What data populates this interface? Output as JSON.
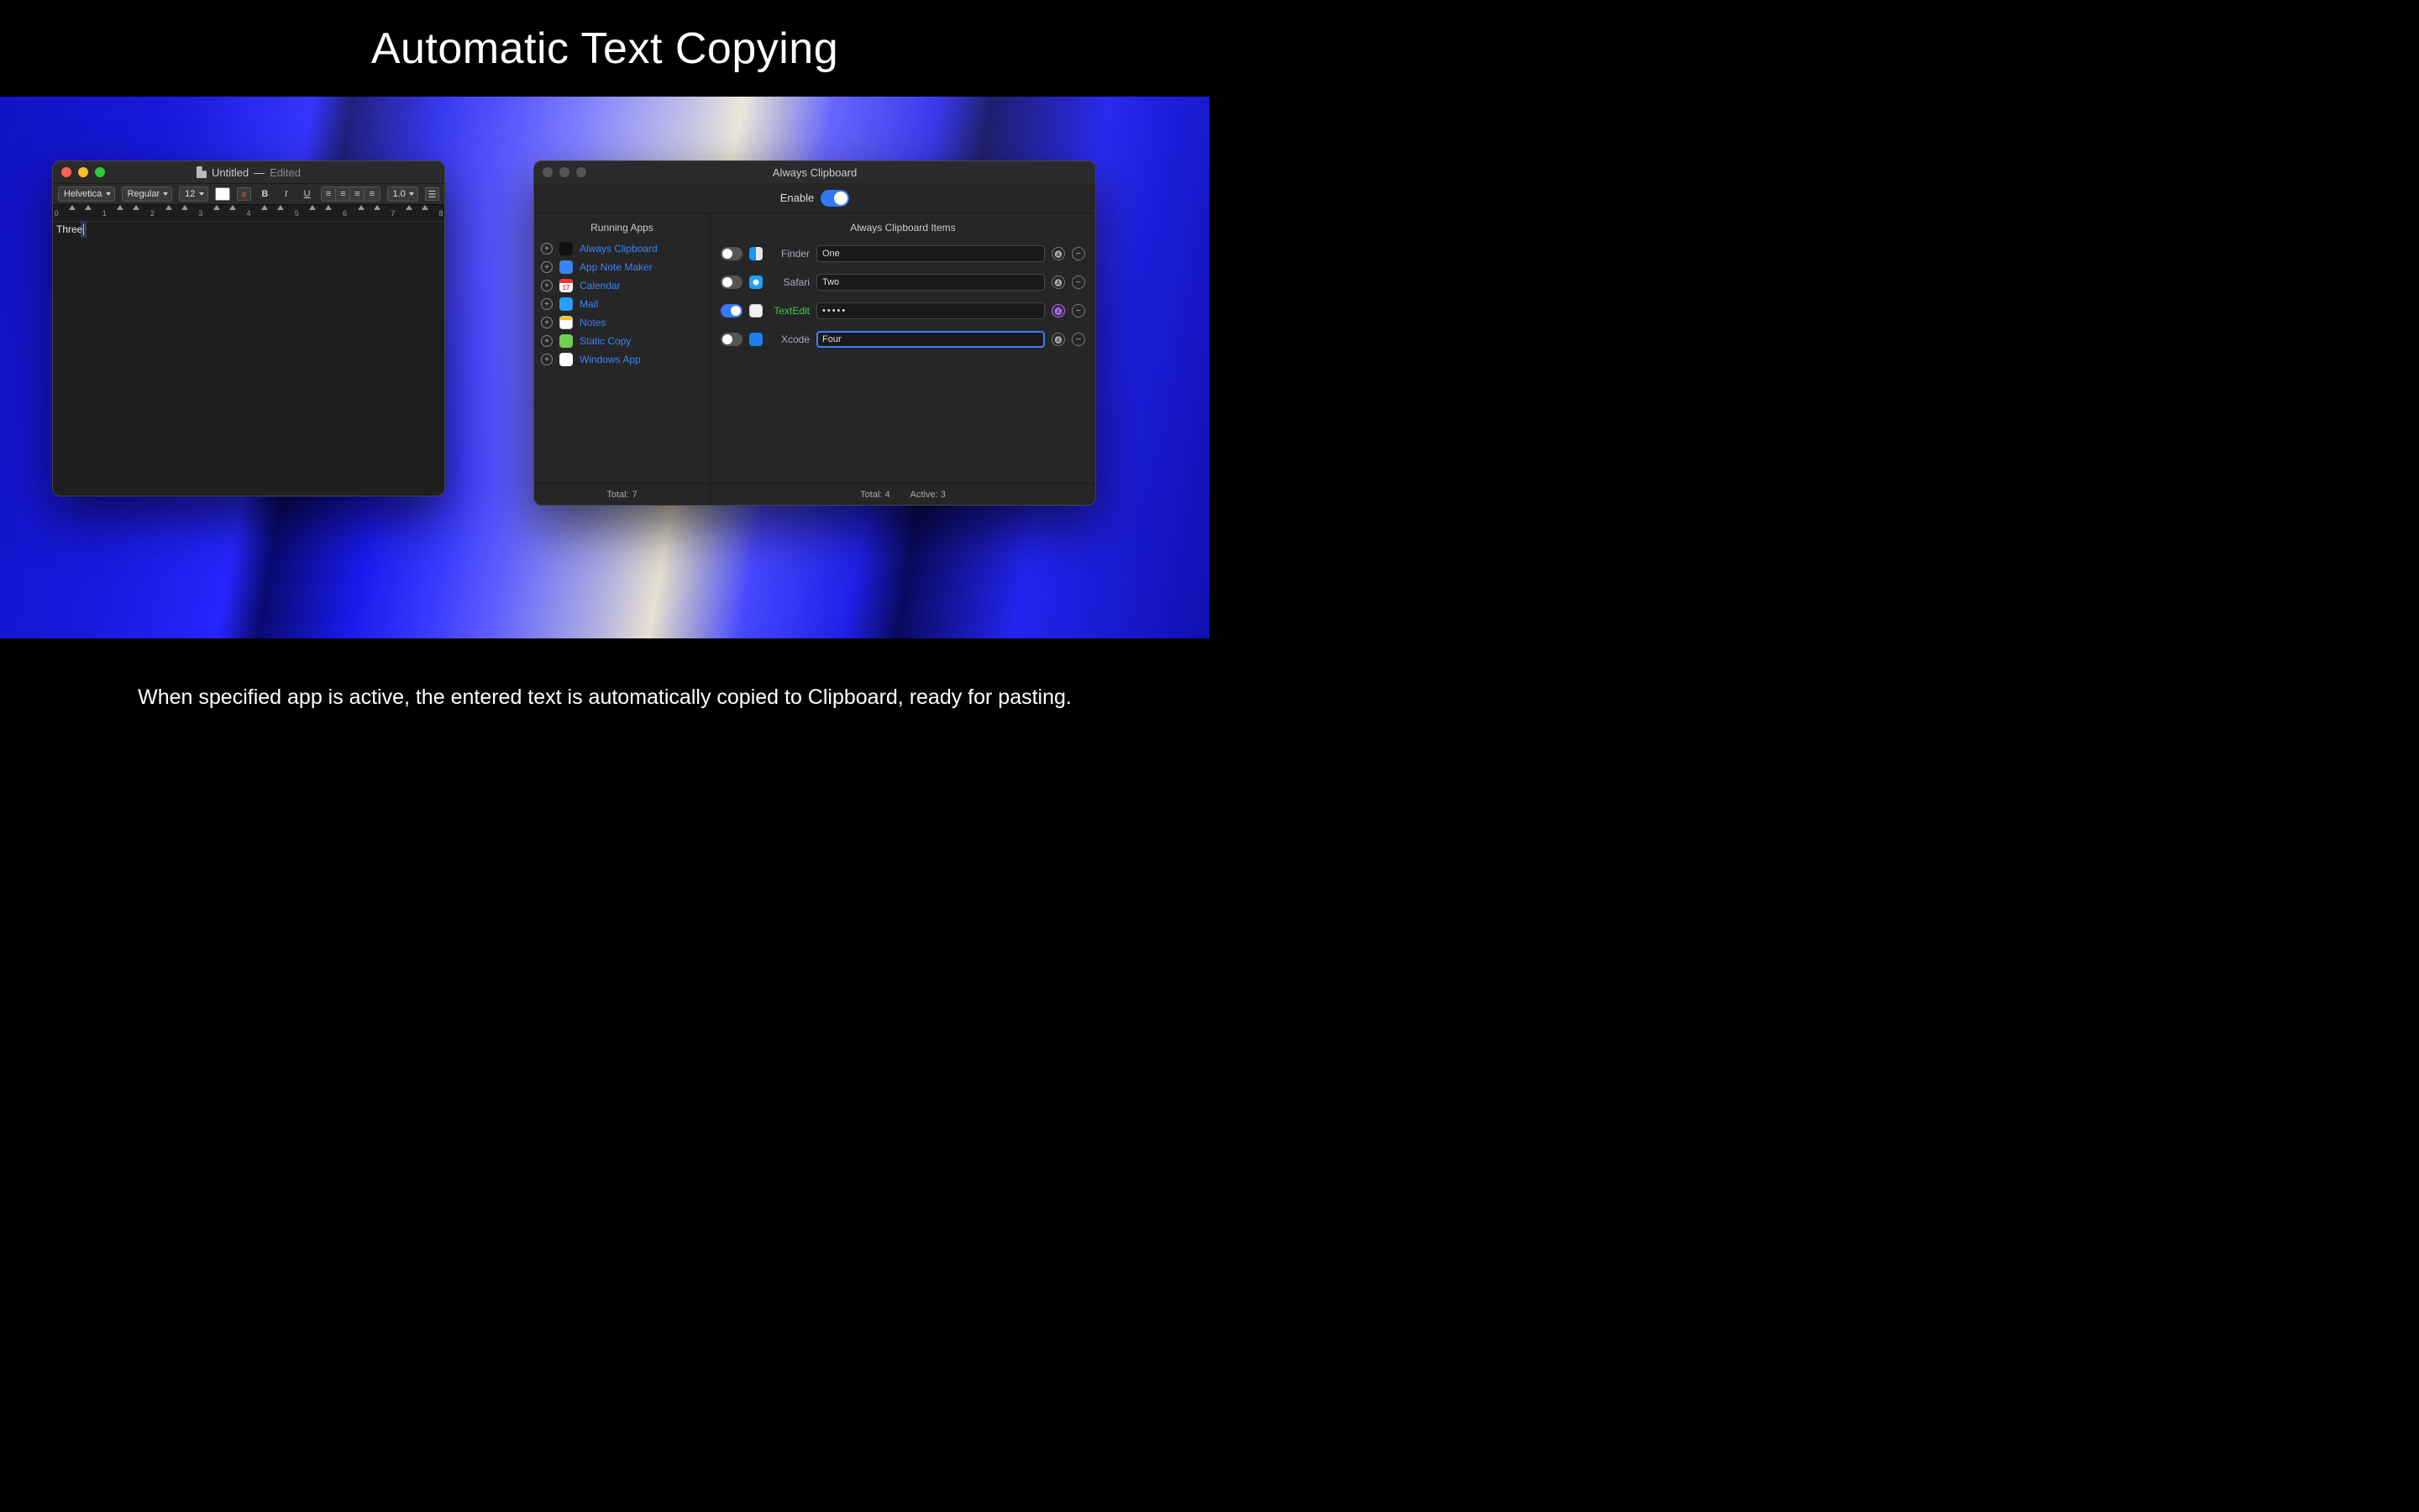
{
  "header": {
    "title": "Automatic Text Copying"
  },
  "footer": {
    "caption": "When specified app is active, the entered text is automatically copied to Clipboard, ready for pasting."
  },
  "textedit": {
    "title_filename": "Untitled",
    "title_status": "Edited",
    "toolbar": {
      "font_family": "Helvetica",
      "font_style": "Regular",
      "font_size": "12",
      "a_style_label": "a",
      "bold_label": "B",
      "italic_label": "I",
      "underline_label": "U",
      "line_spacing": "1.0"
    },
    "ruler_marks": [
      "0",
      "1",
      "2",
      "3",
      "4",
      "5",
      "6",
      "7",
      "8"
    ],
    "document_text": "Three"
  },
  "clipboard": {
    "window_title": "Always Clipboard",
    "enable_label": "Enable",
    "enable_on": true,
    "left": {
      "header": "Running Apps",
      "apps": [
        {
          "name": "Always Clipboard",
          "icon": "ic-alwaysclip"
        },
        {
          "name": "App Note Maker",
          "icon": "ic-appnote"
        },
        {
          "name": "Calendar",
          "icon": "ic-calendar",
          "badge": "17"
        },
        {
          "name": "Mail",
          "icon": "ic-mail"
        },
        {
          "name": "Notes",
          "icon": "ic-notes"
        },
        {
          "name": "Static Copy",
          "icon": "ic-static"
        },
        {
          "name": "Windows App",
          "icon": "ic-windows"
        }
      ],
      "total_label": "Total:",
      "total_value": "7"
    },
    "right": {
      "header": "Always Clipboard Items",
      "items": [
        {
          "app": "Finder",
          "icon": "ic-finder",
          "value": "One",
          "on": false,
          "active": false,
          "masked": false,
          "focused": false,
          "auto_purple": false
        },
        {
          "app": "Safari",
          "icon": "ic-safari",
          "value": "Two",
          "on": false,
          "active": false,
          "masked": false,
          "focused": false,
          "auto_purple": false
        },
        {
          "app": "TextEdit",
          "icon": "ic-textedit",
          "value": "•••••",
          "on": true,
          "active": true,
          "masked": true,
          "focused": false,
          "auto_purple": true
        },
        {
          "app": "Xcode",
          "icon": "ic-xcode",
          "value": "Four",
          "on": false,
          "active": false,
          "masked": false,
          "focused": true,
          "auto_purple": false
        }
      ],
      "total_label": "Total:",
      "total_value": "4",
      "active_label": "Active:",
      "active_value": "3"
    }
  }
}
